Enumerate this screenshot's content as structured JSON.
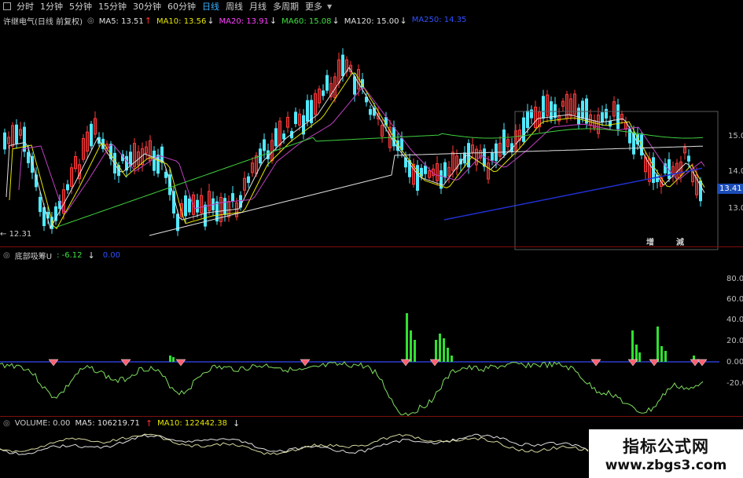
{
  "toolbar": {
    "tabs": [
      "分时",
      "1分钟",
      "5分钟",
      "15分钟",
      "30分钟",
      "60分钟",
      "日线",
      "周线",
      "月线",
      "多周期",
      "更多"
    ],
    "active_index": 6
  },
  "main_panel": {
    "stock_name": "许继电气(日线 前复权)",
    "ma": [
      {
        "label": "MA5: 13.51",
        "color": "#e0e0e0",
        "arrow": "↑",
        "arrow_color": "#ff3030"
      },
      {
        "label": "MA10: 13.56",
        "color": "#e6e600",
        "arrow": "↓",
        "arrow_color": "#e0e0e0"
      },
      {
        "label": "MA20: 13.91",
        "color": "#ff40ff",
        "arrow": "↓",
        "arrow_color": "#e0e0e0"
      },
      {
        "label": "MA60: 15.08",
        "color": "#40e040",
        "arrow": "↓",
        "arrow_color": "#e0e0e0"
      },
      {
        "label": "MA120: 15.00",
        "color": "#e0e0e0",
        "arrow": "↓",
        "arrow_color": "#e0e0e0"
      },
      {
        "label": "MA250: 14.35",
        "color": "#3050ff",
        "arrow": "",
        "arrow_color": "#e0e0e0"
      }
    ],
    "y_labels": [
      "15.0",
      "14.0",
      "13.0"
    ],
    "price_tag": "13.41",
    "low_label": "12.31",
    "signals": [
      {
        "text": "增",
        "color": "#ff9a2e"
      },
      {
        "text": "減",
        "color": "#ff9a2e"
      }
    ]
  },
  "indicator_panel": {
    "name": "底部吸筹U",
    "value_label": ": -6.12",
    "value_arrow": "↓",
    "second_value": "0.00",
    "y_labels": [
      "80.00",
      "60.00",
      "40.00",
      "20.00",
      "0.00",
      "-20.00"
    ]
  },
  "volume_panel": {
    "label": "VOLUME: 0.00",
    "ma5": "MA5: 106219.71",
    "ma5_arrow": "↑",
    "ma10": "MA10: 122442.38",
    "ma10_arrow": "↓"
  },
  "watermark": {
    "title": "指标公式网",
    "url": "www.zbgs3.com"
  },
  "colors": {
    "up": "#ff3a3a",
    "down": "#50e8ff",
    "ma5": "#e0e0e0",
    "ma10": "#e6e600",
    "ma20": "#c040c0",
    "ma60": "#40d040",
    "ma250": "#2030d0",
    "accent": "#3ab0ff"
  }
}
